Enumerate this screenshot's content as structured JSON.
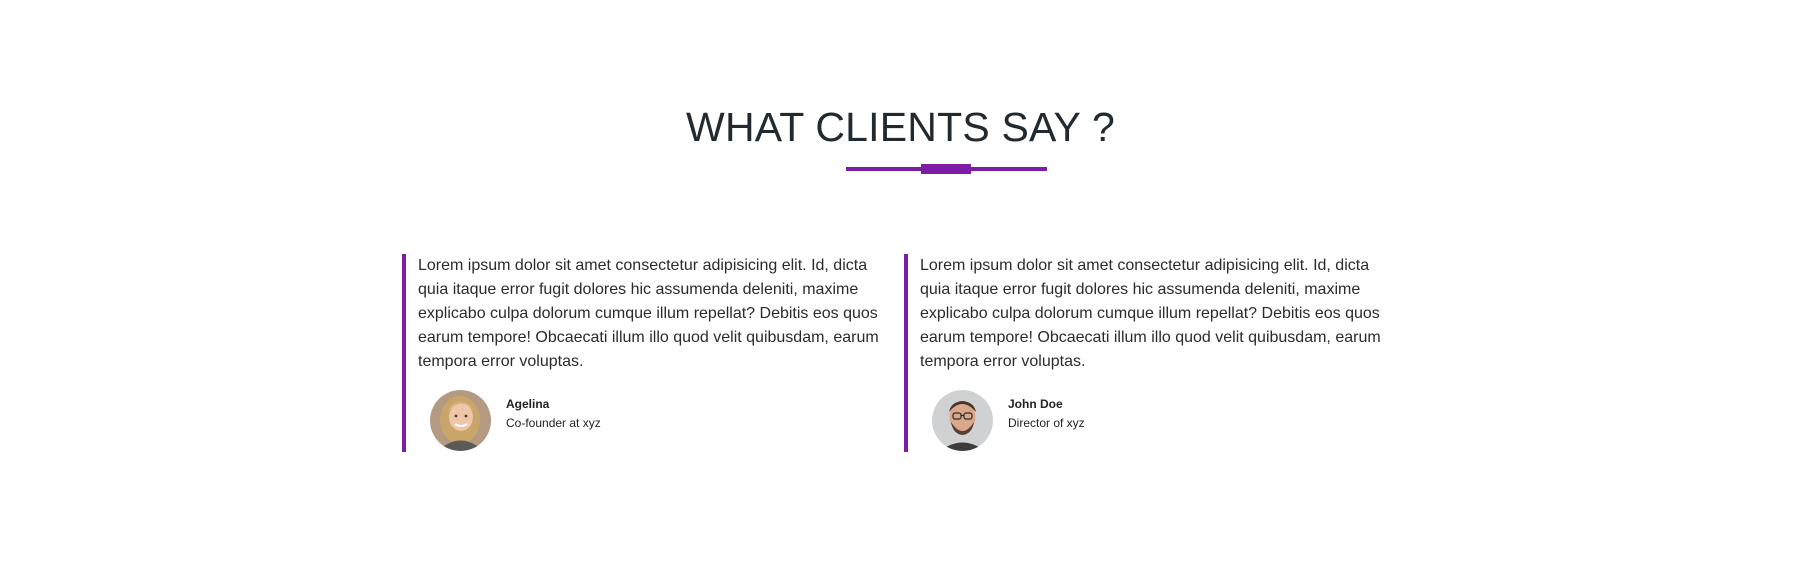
{
  "section": {
    "title": "WHAT CLIENTS SAY ?",
    "accent_color": "#7f1ca6"
  },
  "testimonials": [
    {
      "quote": "Lorem ipsum dolor sit amet consectetur adipisicing elit. Id, dicta quia itaque error fugit dolores hic assumenda deleniti, maxime explicabo culpa dolorum cumque illum repellat? Debitis eos quos earum tempore! Obcaecati illum illo quod velit quibusdam, earum tempora error voluptas.",
      "name": "Agelina",
      "role": "Co-founder at xyz",
      "avatar_icon": "woman-avatar"
    },
    {
      "quote": "Lorem ipsum dolor sit amet consectetur adipisicing elit. Id, dicta quia itaque error fugit dolores hic assumenda deleniti, maxime explicabo culpa dolorum cumque illum repellat? Debitis eos quos earum tempore! Obcaecati illum illo quod velit quibusdam, earum tempora error voluptas.",
      "name": "John Doe",
      "role": "Director of xyz",
      "avatar_icon": "man-avatar"
    }
  ]
}
